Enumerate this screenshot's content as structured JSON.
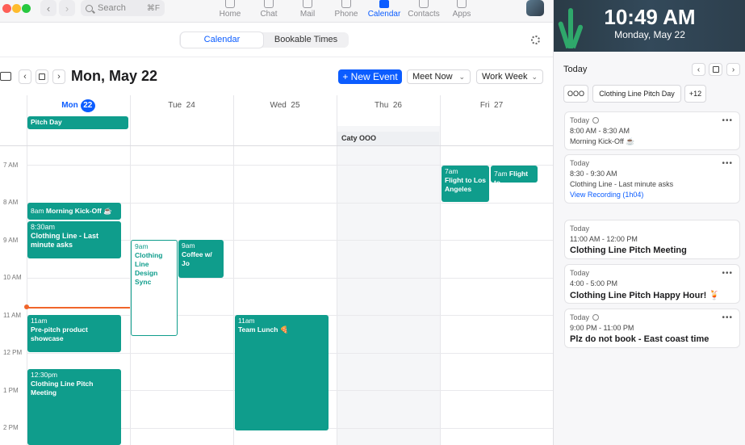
{
  "search": {
    "placeholder": "Search",
    "shortcut": "⌘F"
  },
  "nav_tabs": [
    {
      "label": "Home",
      "icon": "home-icon"
    },
    {
      "label": "Chat",
      "icon": "chat-icon"
    },
    {
      "label": "Mail",
      "icon": "mail-icon"
    },
    {
      "label": "Phone",
      "icon": "phone-icon"
    },
    {
      "label": "Calendar",
      "icon": "calendar-icon",
      "active": true
    },
    {
      "label": "Contacts",
      "icon": "contacts-icon"
    },
    {
      "label": "Apps",
      "icon": "apps-icon"
    }
  ],
  "subtabs": {
    "calendar": "Calendar",
    "bookable": "Bookable Times"
  },
  "toolbar": {
    "date_title": "Mon, May 22",
    "new_event": "+ New Event",
    "meet_now": "Meet Now",
    "view": "Work Week"
  },
  "days": [
    {
      "name": "Mon",
      "num": "22",
      "today": true
    },
    {
      "name": "Tue",
      "num": "24"
    },
    {
      "name": "Wed",
      "num": "25"
    },
    {
      "name": "Thu",
      "num": "26"
    },
    {
      "name": "Fri",
      "num": "27"
    }
  ],
  "hours": [
    "7 AM",
    "8 AM",
    "9 AM",
    "10 AM",
    "11 AM",
    "12 PM",
    "1 PM",
    "2 PM"
  ],
  "allday": {
    "pitch_day": "Pitch Day",
    "caty_ooo": "Caty OOO"
  },
  "events": {
    "kickoff": {
      "time": "8am",
      "title": "Morning Kick-Off ☕"
    },
    "clothing_asks": {
      "time": "8:30am",
      "title": "Clothing Line - Last minute asks"
    },
    "design_sync": {
      "time": "9am",
      "title": "Clothing Line Design Sync"
    },
    "coffee": {
      "time": "9am",
      "title": "Coffee w/ Jo"
    },
    "preshowcase": {
      "time": "11am",
      "title": "Pre-pitch product showcase"
    },
    "pitch_meeting": {
      "time": "12:30pm",
      "title": "Clothing Line Pitch Meeting"
    },
    "team_lunch": {
      "time": "11am",
      "title": "Team Lunch 🍕"
    },
    "flight_la": {
      "time": "7am",
      "title": "Flight to Los Angeles"
    },
    "flight_to": {
      "time": "7am",
      "title": "Flight to"
    }
  },
  "lockscreen": {
    "time": "10:49 AM",
    "date": "Monday, May 22"
  },
  "right_pane": {
    "heading": "Today",
    "chips": [
      "OOO",
      "Clothing Line Pitch Day",
      "+12"
    ],
    "cards": [
      {
        "day": "Today",
        "time": "8:00 AM - 8:30 AM",
        "title": "Morning Kick-Off ☕",
        "recurring": true
      },
      {
        "day": "Today",
        "time": "8:30 - 9:30 AM",
        "title": "Clothing Line - Last minute asks",
        "link": "View Recording (1h04)"
      },
      {
        "day": "Today",
        "time": "11:00 AM - 12:00 PM",
        "title": "Clothing Line Pitch Meeting"
      },
      {
        "day": "Today",
        "time": "4:00 - 5:00 PM",
        "title": "Clothing Line Pitch Happy Hour! 🍹"
      },
      {
        "day": "Today",
        "time": "9:00 PM - 11:00 PM",
        "title": "Plz do not book - East coast time",
        "recurring": true
      }
    ]
  },
  "colors": {
    "accent": "#0b5cff",
    "event": "#0f9d8c",
    "now": "#f0652a"
  }
}
